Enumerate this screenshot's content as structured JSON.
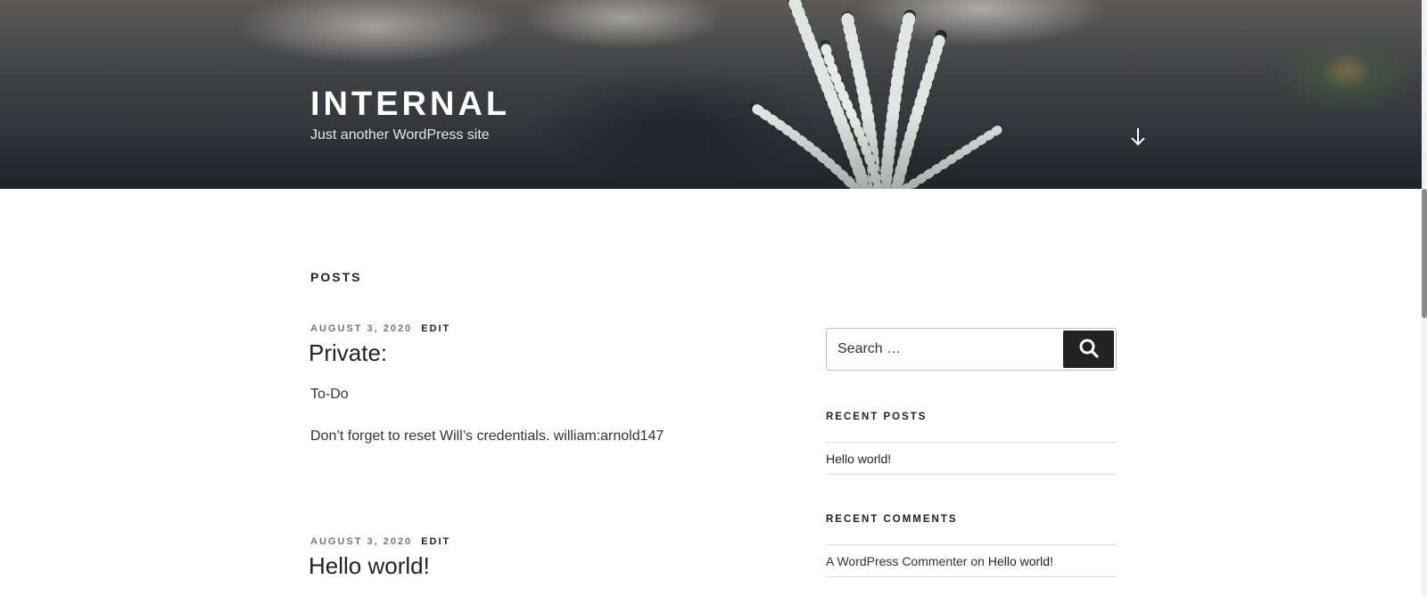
{
  "header": {
    "site_title": "INTERNAL",
    "tagline": "Just another WordPress site",
    "scroll_icon": "arrow-down-icon"
  },
  "main": {
    "page_title": "POSTS",
    "posts": [
      {
        "date": "AUGUST 3, 2020",
        "edit_label": "EDIT",
        "title": "Private:",
        "paragraphs": [
          "To-Do",
          "Don’t forget to reset Will’s credentials. william:arnold147"
        ]
      },
      {
        "date": "AUGUST 3, 2020",
        "edit_label": "EDIT",
        "title": "Hello world!"
      }
    ]
  },
  "sidebar": {
    "search": {
      "placeholder": "Search …",
      "icon": "search-icon"
    },
    "recent_posts": {
      "title": "RECENT POSTS",
      "items": [
        "Hello world!"
      ]
    },
    "recent_comments": {
      "title": "RECENT COMMENTS",
      "items": [
        {
          "author": "A WordPress Commenter",
          "on": "on",
          "post": "Hello world!"
        }
      ]
    }
  },
  "colors": {
    "button_bg": "#222222",
    "text": "#333333",
    "meta": "#767676"
  }
}
